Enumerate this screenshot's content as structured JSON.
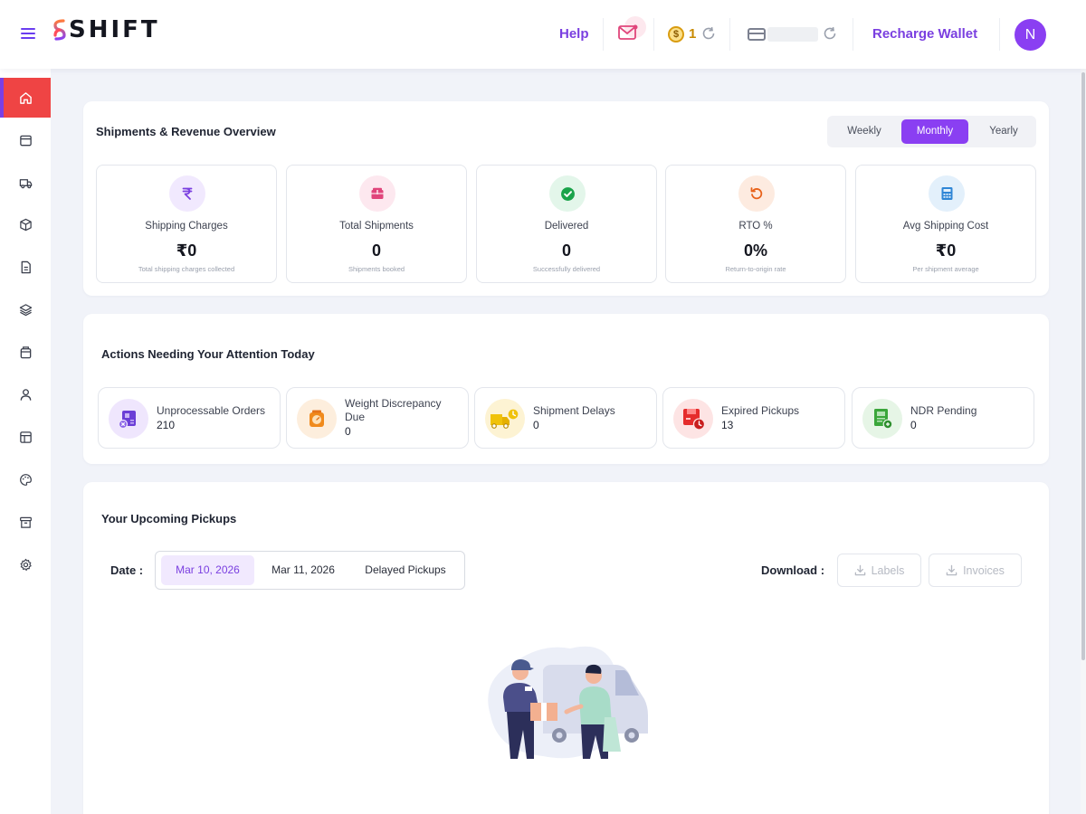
{
  "header": {
    "logo_text": "SHIFT",
    "help_label": "Help",
    "coin_symbol": "$",
    "coin_balance": "1",
    "recharge_label": "Recharge Wallet",
    "avatar_initial": "N"
  },
  "sidebar": {
    "items": [
      {
        "icon": "home-icon",
        "active": true
      },
      {
        "icon": "window-icon"
      },
      {
        "icon": "truck-icon"
      },
      {
        "icon": "box-icon"
      },
      {
        "icon": "document-icon"
      },
      {
        "icon": "layers-icon"
      },
      {
        "icon": "package-icon"
      },
      {
        "icon": "user-icon"
      },
      {
        "icon": "layout-icon"
      },
      {
        "icon": "palette-icon"
      },
      {
        "icon": "archive-icon"
      },
      {
        "icon": "settings-icon"
      }
    ]
  },
  "overview": {
    "title": "Shipments & Revenue Overview",
    "periods": [
      "Weekly",
      "Monthly",
      "Yearly"
    ],
    "active_period": "Monthly",
    "cards": [
      {
        "icon": "rupee-icon",
        "label": "Shipping Charges",
        "value": "₹0",
        "sub": "Total shipping charges collected",
        "color": "#7a3fe0",
        "bg": "#f1e9fe"
      },
      {
        "icon": "box-icon",
        "label": "Total Shipments",
        "value": "0",
        "sub": "Shipments booked",
        "color": "#e0457b",
        "bg": "#fde8ef"
      },
      {
        "icon": "check-circle-icon",
        "label": "Delivered",
        "value": "0",
        "sub": "Successfully delivered",
        "color": "#1aa34a",
        "bg": "#e3f6ea"
      },
      {
        "icon": "undo-icon",
        "label": "RTO %",
        "value": "0%",
        "sub": "Return-to-origin rate",
        "color": "#e8621a",
        "bg": "#fdebe0"
      },
      {
        "icon": "calculator-icon",
        "label": "Avg Shipping Cost",
        "value": "₹0",
        "sub": "Per shipment average",
        "color": "#2f86d6",
        "bg": "#e3f0fb"
      }
    ]
  },
  "actions": {
    "title": "Actions Needing Your Attention Today",
    "cards": [
      {
        "icon": "unprocessable-orders-icon",
        "label": "Unprocessable Orders",
        "count": "210",
        "bg": "#efe6fd"
      },
      {
        "icon": "weighing-scale-icon",
        "label": "Weight Discrepancy Due",
        "count": "0",
        "bg": "#fdeedd"
      },
      {
        "icon": "delayed-truck-icon",
        "label": "Shipment Delays",
        "count": "0",
        "bg": "#fdf3d3"
      },
      {
        "icon": "expired-pickup-icon",
        "label": "Expired Pickups",
        "count": "13",
        "bg": "#fde4e4"
      },
      {
        "icon": "ndr-document-icon",
        "label": "NDR Pending",
        "count": "0",
        "bg": "#e6f5e6"
      }
    ]
  },
  "pickups": {
    "title": "Your Upcoming Pickups",
    "date_label": "Date :",
    "dates": [
      "Mar 10, 2026",
      "Mar 11, 2026",
      "Delayed Pickups"
    ],
    "active_date": "Mar 10, 2026",
    "download_label": "Download :",
    "labels_button": "Labels",
    "invoices_button": "Invoices"
  }
}
